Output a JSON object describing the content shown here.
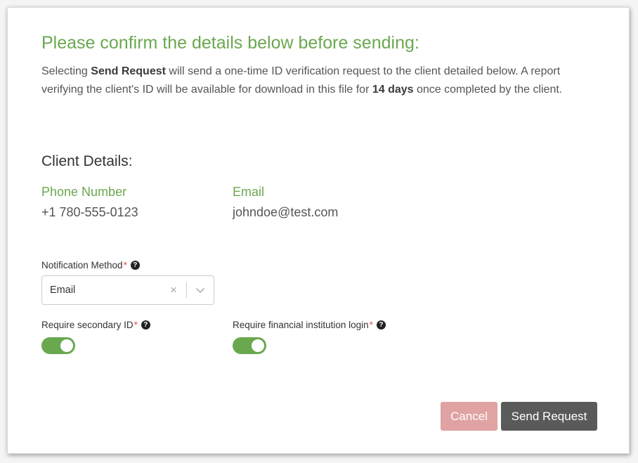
{
  "dialog": {
    "title": "Please confirm the details below before sending:",
    "intro": {
      "part1": "Selecting ",
      "bold1": "Send Request",
      "part2": " will send a one-time ID verification request to the client detailed below. A report verifying the client's ID will be available for download in this file for ",
      "bold2": "14 days",
      "part3": " once completed by the client."
    }
  },
  "client_details": {
    "heading": "Client Details:",
    "phone_label": "Phone Number",
    "phone_value": "+1 780-555-0123",
    "email_label": "Email",
    "email_value": "johndoe@test.com"
  },
  "form": {
    "notification_method": {
      "label": "Notification Method",
      "required_mark": "*",
      "help": "?",
      "value": "Email",
      "clear": "×"
    },
    "secondary_id": {
      "label": "Require secondary ID",
      "required_mark": "*",
      "help": "?",
      "enabled": true
    },
    "financial_login": {
      "label": "Require financial institution login",
      "required_mark": "*",
      "help": "?",
      "enabled": true
    }
  },
  "actions": {
    "cancel_label": "Cancel",
    "send_label": "Send Request"
  },
  "colors": {
    "accent_green": "#6aa84f",
    "cancel_bg": "#e0a2a2",
    "send_bg": "#5a5a5a",
    "required_red": "#d9534f"
  },
  "icons": {
    "help": "question-circle-icon",
    "clear": "close-icon",
    "dropdown": "chevron-down-icon"
  }
}
